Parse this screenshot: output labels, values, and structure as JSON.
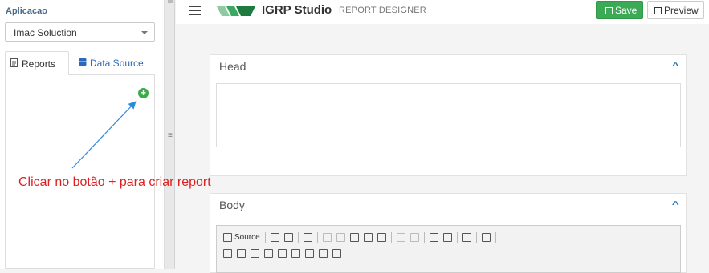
{
  "sidebar": {
    "app_label": "Aplicacao",
    "app_select_value": "Imac Soluction",
    "tabs": [
      {
        "label": "Reports",
        "active": true,
        "icon": "file-icon"
      },
      {
        "label": "Data Source",
        "active": false,
        "icon": "database-icon"
      }
    ],
    "add_icon": "plus-circle-icon"
  },
  "topbar": {
    "brand": "IGRP Studio",
    "subtitle": "REPORT DESIGNER",
    "save_label": "Save",
    "preview_label": "Preview"
  },
  "panels": {
    "head_title": "Head",
    "body_title": "Body"
  },
  "editor": {
    "source_label": "Source"
  },
  "annotation": {
    "text": "Clicar no botão + para criar report"
  },
  "colors": {
    "save_green": "#3aaa55",
    "link_blue": "#2a6ab8",
    "annotation_red": "#e02020",
    "arrow_blue": "#2a8ae0"
  }
}
